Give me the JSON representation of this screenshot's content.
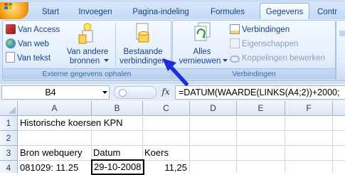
{
  "tabs": [
    {
      "label": "Start",
      "active": false
    },
    {
      "label": "Invoegen",
      "active": false
    },
    {
      "label": "Pagina-indeling",
      "active": false
    },
    {
      "label": "Formules",
      "active": false
    },
    {
      "label": "Gegevens",
      "active": true
    },
    {
      "label": "Contr",
      "active": false
    }
  ],
  "ribbon": {
    "external_data": {
      "from_access": "Van Access",
      "from_web": "Van web",
      "from_text": "Van tekst",
      "other_sources_line1": "Van andere",
      "other_sources_line2": "bronnen",
      "existing_line1": "Bestaande",
      "existing_line2": "verbindingen",
      "caption": "Externe gegevens ophalen"
    },
    "connections": {
      "refresh_all_line1": "Alles",
      "refresh_all_line2": "vernieuwen",
      "connections": "Verbindingen",
      "properties": "Eigenschappen",
      "edit_links": "Koppelingen bewerken",
      "caption": "Verbindingen"
    }
  },
  "formula_bar": {
    "name_box": "B4",
    "fx": "fx",
    "formula": "=DATUM(WAARDE(LINKS(A4;2))+2000;"
  },
  "grid": {
    "columns": [
      "A",
      "B",
      "C",
      "D",
      "E",
      "F"
    ],
    "rows": [
      "1",
      "2",
      "3",
      "4"
    ],
    "cells": {
      "A1": "Historische koersen KPN",
      "A3": "Bron webquery",
      "B3": "Datum",
      "C3": "Koers",
      "A4": "081029: 11.25",
      "B4": "29-10-2008",
      "C4": "11,25"
    }
  },
  "colors": {
    "accent": "#15428b",
    "annotation_arrow": "#1f2fd8",
    "refresh_icon": "#2f9a3a"
  }
}
